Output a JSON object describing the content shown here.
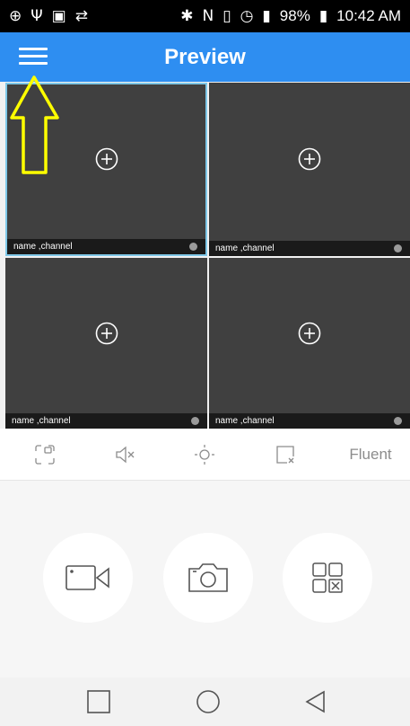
{
  "status_bar": {
    "battery": "98%",
    "time": "10:42 AM",
    "left_icons": [
      "crosshair-icon",
      "usb-icon",
      "gallery-icon",
      "sync-icon"
    ],
    "right_icons": [
      "bluetooth-icon",
      "nfc-icon",
      "vibrate-icon",
      "alarm-icon",
      "signal-icon",
      "battery-icon"
    ]
  },
  "app_bar": {
    "title": "Preview",
    "menu_icon": "hamburger-menu-icon",
    "accent_color": "#2e8ef1"
  },
  "video_grid": {
    "selected_index": 0,
    "cells": [
      {
        "label": "name ,channel",
        "icon": "add-circle-icon"
      },
      {
        "label": "name ,channel",
        "icon": "add-circle-icon"
      },
      {
        "label": "name ,channel",
        "icon": "add-circle-icon"
      },
      {
        "label": "name ,channel",
        "icon": "add-circle-icon"
      }
    ]
  },
  "toolbar": {
    "items": [
      "fullscreen-icon",
      "mute-icon",
      "ptz-icon",
      "close-window-icon"
    ],
    "quality_label": "Fluent"
  },
  "controls": {
    "buttons": [
      "record-video-icon",
      "snapshot-camera-icon",
      "close-all-windows-icon"
    ]
  },
  "nav_bar": {
    "buttons": [
      "recent-apps-icon",
      "home-icon",
      "back-icon"
    ]
  },
  "annotation": {
    "arrow_color": "#ffff00"
  }
}
